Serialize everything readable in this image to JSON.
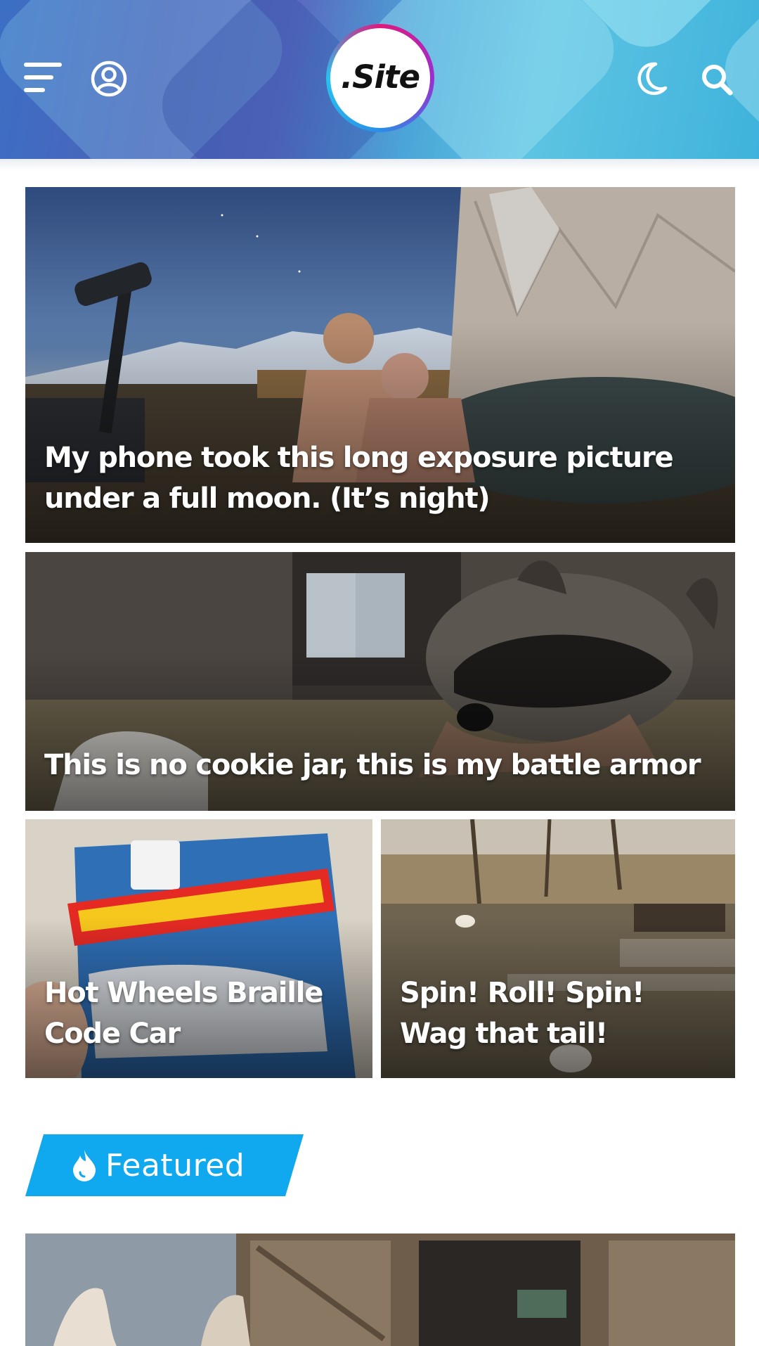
{
  "header": {
    "logo_text": ".Site",
    "icons": {
      "menu": "hamburger-menu-icon",
      "user": "user-circle-icon",
      "theme": "moon-icon",
      "search": "search-icon"
    },
    "colors": {
      "logo_ring": [
        "#e0197d",
        "#9b2ecf",
        "#2a8ee8",
        "#27c3ee"
      ],
      "header_start": "#3b6fc4",
      "header_end": "#3fb3dc"
    }
  },
  "posts": [
    {
      "title": "My phone took this long exposure picture under a full moon. (It’s night)"
    },
    {
      "title": "This is no cookie jar, this is my battle armor"
    },
    {
      "title": "Hot Wheels Braille Code Car"
    },
    {
      "title": "Spin! Roll! Spin! Wag that tail!"
    }
  ],
  "featured": {
    "label": "Featured",
    "icon": "flame-icon",
    "color": "#10a8ee"
  }
}
